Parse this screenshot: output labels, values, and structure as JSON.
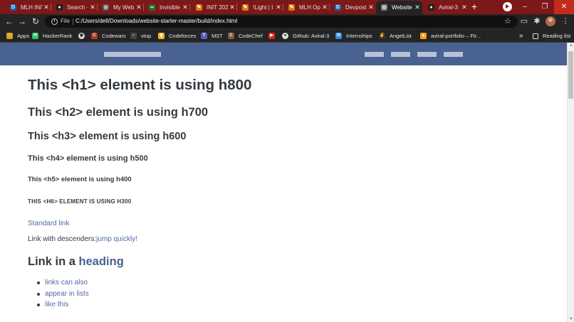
{
  "browser": {
    "tabs": [
      {
        "title": "MLH INIT",
        "icon": "devpost-d-icon",
        "color": "#1d5fa8",
        "glyph": "D"
      },
      {
        "title": "Search ·",
        "icon": "github-icon",
        "color": "#222222",
        "glyph": "●"
      },
      {
        "title": "My Web",
        "icon": "globe-icon",
        "color": "#555555",
        "glyph": "◎"
      },
      {
        "title": "Invisible",
        "icon": "mlh-icon",
        "color": "#2b6a38",
        "glyph": "∞"
      },
      {
        "title": "INIT 202",
        "icon": "pen-icon",
        "color": "#d97a1a",
        "glyph": "✎"
      },
      {
        "title": "!Light | I",
        "icon": "pen-icon",
        "color": "#d97a1a",
        "glyph": "✎"
      },
      {
        "title": "MLH Op",
        "icon": "pen-icon",
        "color": "#d97a1a",
        "glyph": "✎"
      },
      {
        "title": "Devpost",
        "icon": "devpost-d-icon",
        "color": "#1d5fa8",
        "glyph": "D"
      },
      {
        "title": "Website",
        "icon": "globe-icon",
        "color": "#777777",
        "glyph": "◎",
        "active": true
      },
      {
        "title": "Aviral-3",
        "icon": "github-icon",
        "color": "#222222",
        "glyph": "●"
      }
    ],
    "new_tab": "+",
    "window_controls": {
      "minimize": "–",
      "restore": "❐",
      "close": "✕"
    },
    "nav": {
      "back": "←",
      "forward": "→",
      "reload": "↻"
    },
    "address": {
      "scheme_label": "File",
      "url": "C:/Users/dell/Downloads/website-starter-master/build/index.html"
    },
    "star": "☆",
    "toolbar_icons": {
      "cast": "▭",
      "extensions": "✱",
      "menu": "⋮"
    },
    "bookmarks": [
      {
        "label": "Apps",
        "icon": "apps-grid-icon",
        "color": "#e0a020",
        "glyph": "⁝"
      },
      {
        "label": "HackerRank",
        "icon": "hackerrank-icon",
        "color": "#2ec866",
        "glyph": "H"
      },
      {
        "label": "",
        "icon": "globe-icon",
        "color": "#dddddd",
        "glyph": "◉"
      },
      {
        "label": "Codewars",
        "icon": "codewars-icon",
        "color": "#b1361e",
        "glyph": "C"
      },
      {
        "label": "vtop",
        "icon": "vtop-icon",
        "color": "#444444",
        "glyph": "○"
      },
      {
        "label": "Codeforces",
        "icon": "codeforces-icon",
        "color": "#f2b92a",
        "glyph": "▮"
      },
      {
        "label": "MST",
        "icon": "teams-icon",
        "color": "#5b5fc7",
        "glyph": "T"
      },
      {
        "label": "CodeChef",
        "icon": "codechef-icon",
        "color": "#7b5b3a",
        "glyph": "C"
      },
      {
        "label": "",
        "icon": "youtube-icon",
        "color": "#e02020",
        "glyph": "▶"
      },
      {
        "label": "Github: Aviral-3",
        "icon": "github-icon",
        "color": "#dddddd",
        "glyph": "●"
      },
      {
        "label": "Internships",
        "icon": "internshala-icon",
        "color": "#2b8be0",
        "glyph": "IS"
      },
      {
        "label": "AngelList",
        "icon": "angellist-icon",
        "color": "#333333",
        "glyph": "✌"
      },
      {
        "label": "aviral-portfolio – Fir...",
        "icon": "firebase-icon",
        "color": "#f6a01a",
        "glyph": "▲"
      }
    ],
    "bookmarks_more": "»",
    "reading_list": {
      "label": "Reading list",
      "icon": "reading-list-icon"
    }
  },
  "page": {
    "header_color": "#4a6290",
    "accent": "#4e6aa8",
    "h1": "This <h1> element is using h800",
    "h2": "This <h2> element is using h700",
    "h3": "This <h3> element is using h600",
    "h4": "This <h4> element is using h500",
    "h5": "This <h5> element is using h400",
    "h6": "This <h6> element is using h300",
    "standard_link": "Standard link",
    "descenders_prefix": "Link with descenders:",
    "descenders_link": "jump quickly!",
    "heading_link_prefix": "Link in a ",
    "heading_link": "heading",
    "list_items": [
      "links can also",
      "appear in lists",
      "like this"
    ]
  },
  "scrollbar": {
    "up": "▲",
    "down": "▼"
  }
}
